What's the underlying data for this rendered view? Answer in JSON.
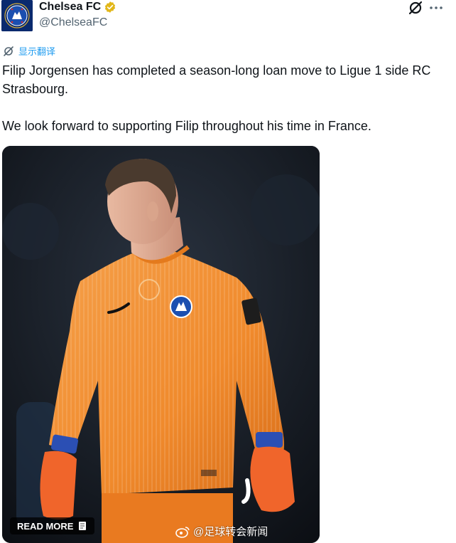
{
  "tweet": {
    "author_name": "Chelsea FC",
    "author_handle": "@ChelseaFC",
    "translate_label": "显示翻译",
    "text_line1": "Filip Jorgensen has completed a season-long loan move to Ligue 1 side RC Strasbourg.",
    "text_line2": "We look forward to supporting Filip throughout his time in France.",
    "verified_color": "#e2b719",
    "link_color": "#1d9bf0"
  },
  "media": {
    "read_more_label": "READ MORE",
    "watermark_text": "@足球转会新闻",
    "kit_color": "#f28a2e"
  },
  "icons": {
    "avatar": "chelsea-crest",
    "verified": "gold-verified-badge",
    "grok": "grok-icon",
    "more": "more-dots",
    "translate": "translate-slash-icon",
    "weibo": "weibo-logo"
  }
}
